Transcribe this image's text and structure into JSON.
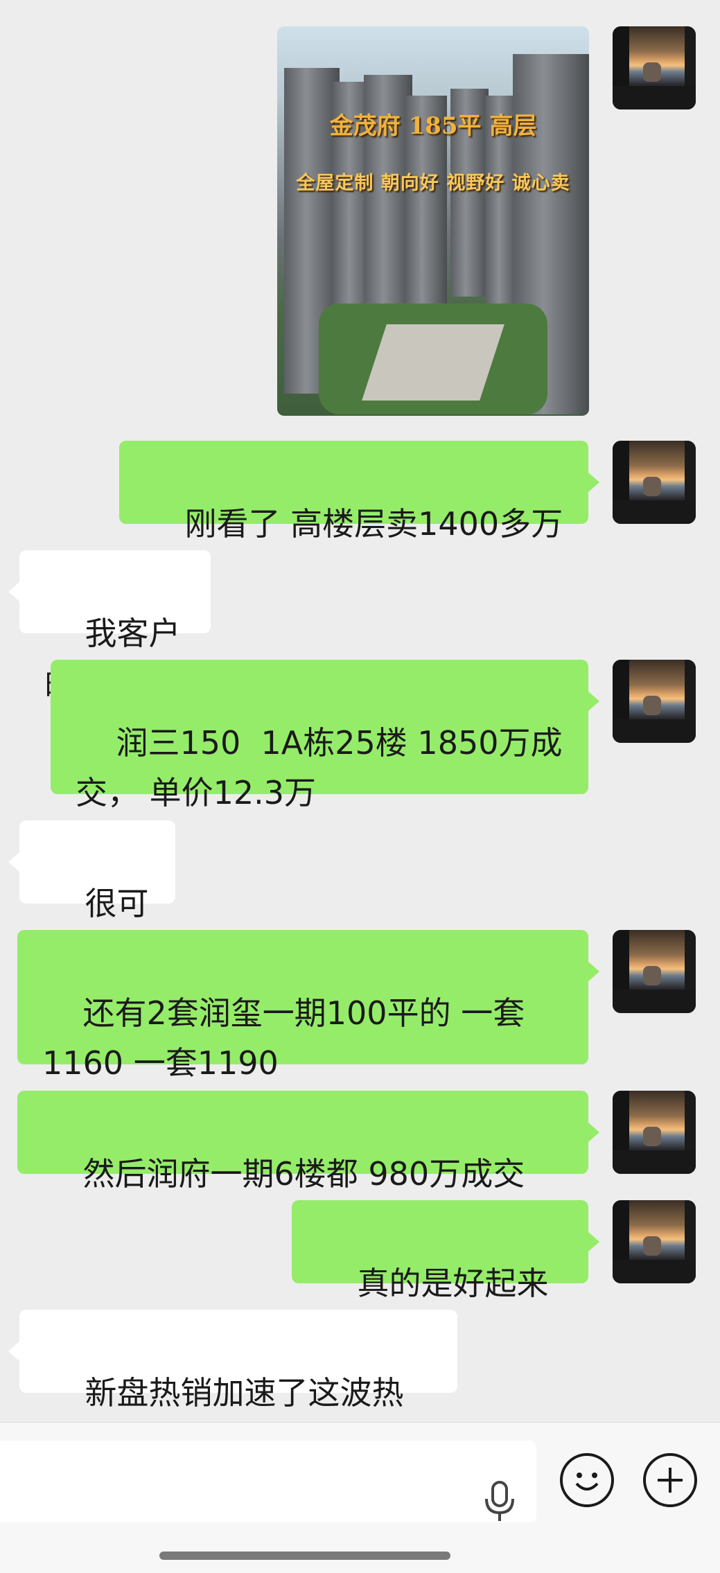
{
  "image_message": {
    "caption_title": "金茂府 185平 高层",
    "caption_subtitle": "全屋定制 朝向好 视野好 诚心卖"
  },
  "messages": [
    {
      "side": "right",
      "text": "刚看了 高楼层卖1400多万"
    },
    {
      "side": "left",
      "text": "我客户的"
    },
    {
      "side": "right",
      "text": "润三150  1A栋25楼 1850万成\n交， 单价12.3万"
    },
    {
      "side": "left",
      "text": "很可以"
    },
    {
      "side": "right",
      "text": "还有2套润玺一期100平的 一套\n1160 一套1190"
    },
    {
      "side": "right",
      "text": "然后润府一期6楼都 980万成交"
    },
    {
      "side": "right",
      "text": "真的是好起来了"
    },
    {
      "side": "left",
      "text": "新盘热销加速了这波热度"
    }
  ],
  "input_bar": {
    "icons": [
      "microphone-icon",
      "emoji-icon",
      "plus-icon"
    ]
  },
  "colors": {
    "background": "#ededed",
    "sent_bubble": "#95ec69",
    "received_bubble": "#ffffff"
  }
}
